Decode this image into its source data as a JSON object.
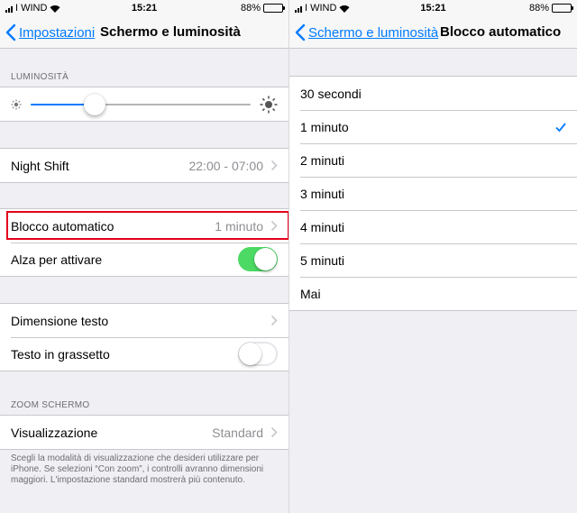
{
  "colors": {
    "accent": "#007aff",
    "toggle_on": "#4cd964",
    "highlight": "#e3001b"
  },
  "left": {
    "status": {
      "carrier": "I WIND",
      "time": "15:21",
      "battery": "88%"
    },
    "nav": {
      "back_label": "Impostazioni",
      "title": "Schermo e luminosità"
    },
    "brightness": {
      "header": "LUMINOSITÀ",
      "level": 0.29
    },
    "night_shift": {
      "label": "Night Shift",
      "value": "22:00 - 07:00"
    },
    "auto_lock": {
      "label": "Blocco automatico",
      "value": "1 minuto"
    },
    "raise_to_wake": {
      "label": "Alza per attivare",
      "on": true
    },
    "text_size": {
      "label": "Dimensione testo"
    },
    "bold_text": {
      "label": "Testo in grassetto",
      "on": false
    },
    "zoom": {
      "header": "ZOOM SCHERMO",
      "view_label": "Visualizzazione",
      "view_value": "Standard",
      "footnote": "Scegli la modalità di visualizzazione che desideri utilizzare per iPhone. Se selezioni “Con zoom”, i controlli avranno dimensioni maggiori. L'impostazione standard mostrerà più contenuto."
    }
  },
  "right": {
    "status": {
      "carrier": "I WIND",
      "time": "15:21",
      "battery": "88%"
    },
    "nav": {
      "back_label": "Schermo e luminosità",
      "title": "Blocco automatico"
    },
    "options": [
      {
        "label": "30 secondi",
        "selected": false
      },
      {
        "label": "1 minuto",
        "selected": true
      },
      {
        "label": "2 minuti",
        "selected": false
      },
      {
        "label": "3 minuti",
        "selected": false
      },
      {
        "label": "4 minuti",
        "selected": false
      },
      {
        "label": "5 minuti",
        "selected": false
      },
      {
        "label": "Mai",
        "selected": false
      }
    ]
  }
}
